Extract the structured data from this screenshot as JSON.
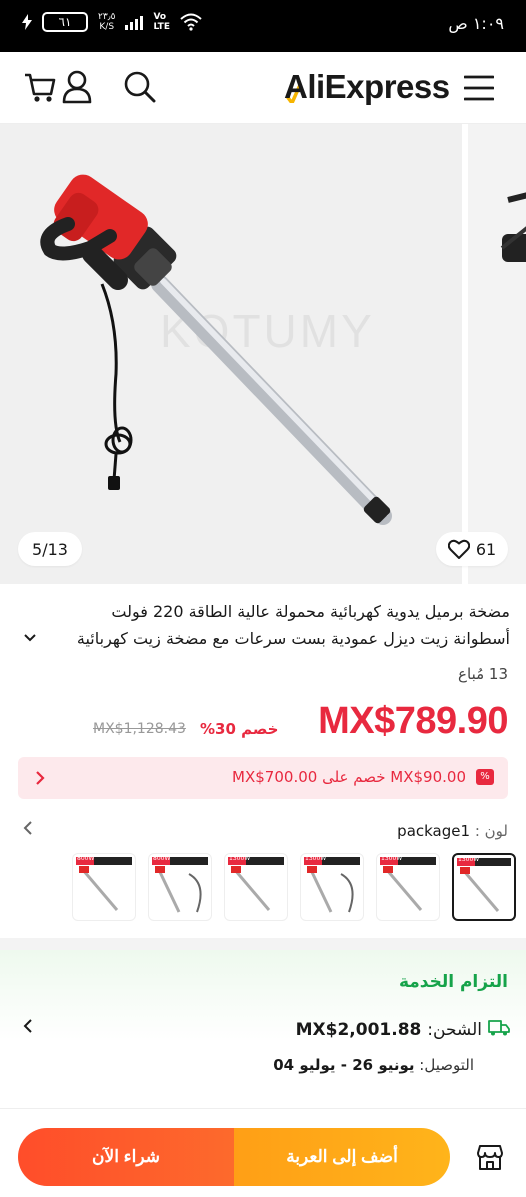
{
  "status_bar": {
    "time": "١:٠٩ ص",
    "battery": "٦١",
    "net_speed_value": "٢٣٫٥",
    "net_speed_unit": "K/S",
    "network_top": "Vo",
    "network_bottom": "LTE"
  },
  "header": {
    "logo_text": "AliExpress",
    "icons": [
      "cart-icon",
      "user-icon",
      "search-icon",
      "menu-icon"
    ]
  },
  "gallery": {
    "watermark": "KOTUMY",
    "counter": "5/13",
    "wishlist_count": "61"
  },
  "product": {
    "title_line1": "مضخة برميل يدوية كهربائية محمولة عالية الطاقة 220 فولت",
    "title_line2": "أسطوانة زيت ديزل عمودية بست سرعات مع مضخة زيت كهربائية",
    "sold": "13 مُباع"
  },
  "price": {
    "current": "MX$789.90",
    "discount": "خصم 30%",
    "original": "MX$1,128.43"
  },
  "coupon": {
    "badge": "%",
    "text": "MX$90.00 خصم على MX$700.00"
  },
  "color": {
    "label": "لون :",
    "selected": "package1",
    "thumbs": [
      "800W",
      "800W",
      "1300W",
      "1300W",
      "1300W",
      "1300W"
    ]
  },
  "service": {
    "title": "التزام الخدمة",
    "shipping_label": "الشحن:",
    "shipping_value": "MX$2,001.88",
    "delivery_label": "التوصيل:",
    "delivery_value": "يونيو 26 - يوليو 04"
  },
  "bottom_bar": {
    "add_to_cart": "أضف إلى العربة",
    "buy_now": "شراء الآن"
  },
  "colors": {
    "accent": "#e8293f",
    "service_green": "#16a34a",
    "buy_orange": "#fd5a2b",
    "cart_orange": "#ffa81a"
  }
}
